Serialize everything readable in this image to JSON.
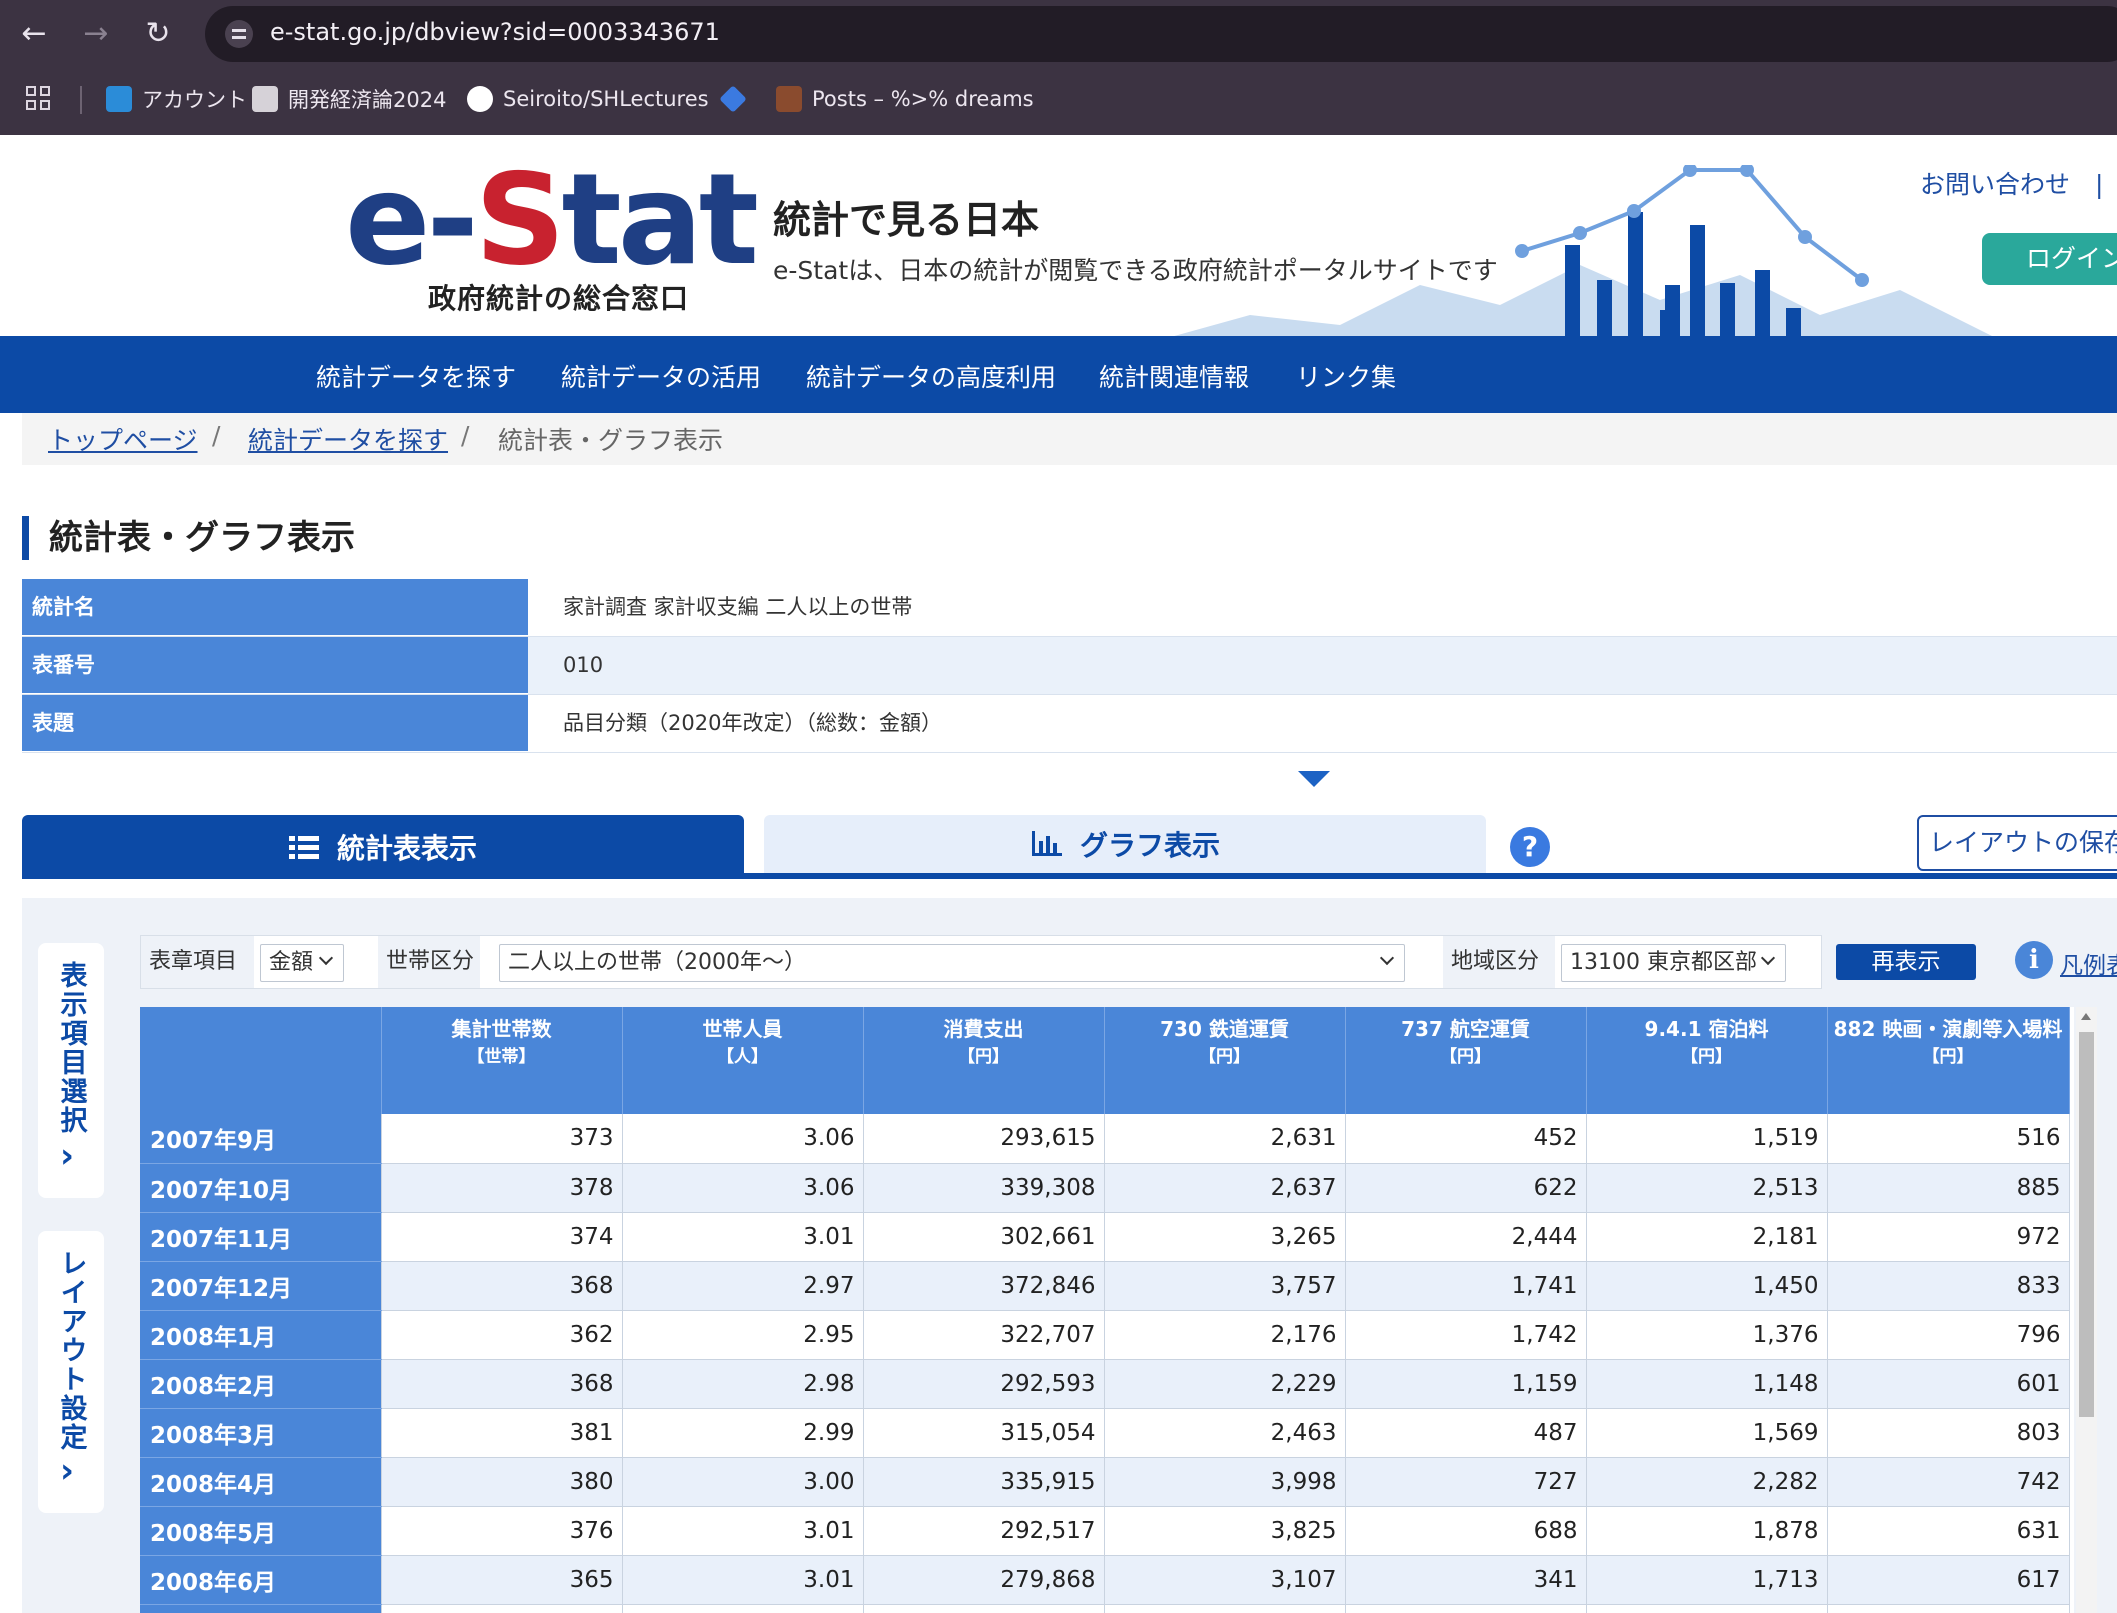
{
  "browser": {
    "url": "e-stat.go.jp/dbview?sid=0003343671",
    "bookmarks": [
      {
        "label": "アカウント",
        "icon": "cloud-account-icon",
        "color": "#2b8cd8"
      },
      {
        "label": "開発経済論2024",
        "icon": "classroom-icon",
        "color": "#5f6368"
      },
      {
        "label": "Seiroito/SHLectures",
        "icon": "github-icon",
        "color": "#ffffff"
      },
      {
        "label": "",
        "icon": "diamond-icon",
        "color": "#3b7ae0"
      },
      {
        "label": "Posts – %>% dreams",
        "icon": "blog-icon",
        "color": "#8a4b2e"
      }
    ]
  },
  "header": {
    "logo_part1": "e-",
    "logo_part2": "S",
    "logo_part3": "tat",
    "logo_sub": "政府統計の総合窓口",
    "tagline_title": "統計で見る日本",
    "tagline_sub": "e-Statは、日本の統計が閲覧できる政府統計ポータルサイトです",
    "contact": "お問い合わせ　|　ヘ",
    "login": "ログイン"
  },
  "nav": [
    "統計データを探す",
    "統計データの活用",
    "統計データの高度利用",
    "統計関連情報",
    "リンク集"
  ],
  "breadcrumb": {
    "home": "トップページ",
    "search": "統計データを探す",
    "current": "統計表・グラフ表示",
    "sep": "/"
  },
  "page_title": "統計表・グラフ表示",
  "info": [
    {
      "label": "統計名",
      "value": "家計調査 家計収支編 二人以上の世帯"
    },
    {
      "label": "表番号",
      "value": "010"
    },
    {
      "label": "表題",
      "value": "品目分類（2020年改定）（総数：金額）"
    }
  ],
  "tabs": {
    "table": "統計表表示",
    "graph": "グラフ表示",
    "help": "?",
    "layout_save": "レイアウトの保存"
  },
  "side": {
    "items": "表示項目選択",
    "layout": "レイアウト設定",
    "chevron": "›"
  },
  "filters": {
    "item_label": "表章項目",
    "item_value": "金額",
    "household_label": "世帯区分",
    "household_value": "二人以上の世帯（2000年～）",
    "region_label": "地域区分",
    "region_value": "13100 東京都区部",
    "redisplay": "再表示",
    "legend": "凡例表"
  },
  "table": {
    "columns": [
      {
        "name": "集計世帯数",
        "unit": "【世帯】"
      },
      {
        "name": "世帯人員",
        "unit": "【人】"
      },
      {
        "name": "消費支出",
        "unit": "【円】"
      },
      {
        "name": "730 鉄道運賃",
        "unit": "【円】"
      },
      {
        "name": "737 航空運賃",
        "unit": "【円】"
      },
      {
        "name": "9.4.1 宿泊料",
        "unit": "【円】"
      },
      {
        "name": "882 映画・演劇等入場料",
        "unit": "【円】"
      }
    ],
    "rows": [
      {
        "period": "2007年9月",
        "values": [
          "373",
          "3.06",
          "293,615",
          "2,631",
          "452",
          "1,519",
          "516"
        ]
      },
      {
        "period": "2007年10月",
        "values": [
          "378",
          "3.06",
          "339,308",
          "2,637",
          "622",
          "2,513",
          "885"
        ]
      },
      {
        "period": "2007年11月",
        "values": [
          "374",
          "3.01",
          "302,661",
          "3,265",
          "2,444",
          "2,181",
          "972"
        ]
      },
      {
        "period": "2007年12月",
        "values": [
          "368",
          "2.97",
          "372,846",
          "3,757",
          "1,741",
          "1,450",
          "833"
        ]
      },
      {
        "period": "2008年1月",
        "values": [
          "362",
          "2.95",
          "322,707",
          "2,176",
          "1,742",
          "1,376",
          "796"
        ]
      },
      {
        "period": "2008年2月",
        "values": [
          "368",
          "2.98",
          "292,593",
          "2,229",
          "1,159",
          "1,148",
          "601"
        ]
      },
      {
        "period": "2008年3月",
        "values": [
          "381",
          "2.99",
          "315,054",
          "2,463",
          "487",
          "1,569",
          "803"
        ]
      },
      {
        "period": "2008年4月",
        "values": [
          "380",
          "3.00",
          "335,915",
          "3,998",
          "727",
          "2,282",
          "742"
        ]
      },
      {
        "period": "2008年5月",
        "values": [
          "376",
          "3.01",
          "292,517",
          "3,825",
          "688",
          "1,878",
          "631"
        ]
      },
      {
        "period": "2008年6月",
        "values": [
          "365",
          "3.01",
          "279,868",
          "3,107",
          "341",
          "1,713",
          "617"
        ]
      },
      {
        "period": "",
        "values": [
          "",
          "",
          "",
          "",
          "",
          "",
          ""
        ]
      }
    ]
  }
}
